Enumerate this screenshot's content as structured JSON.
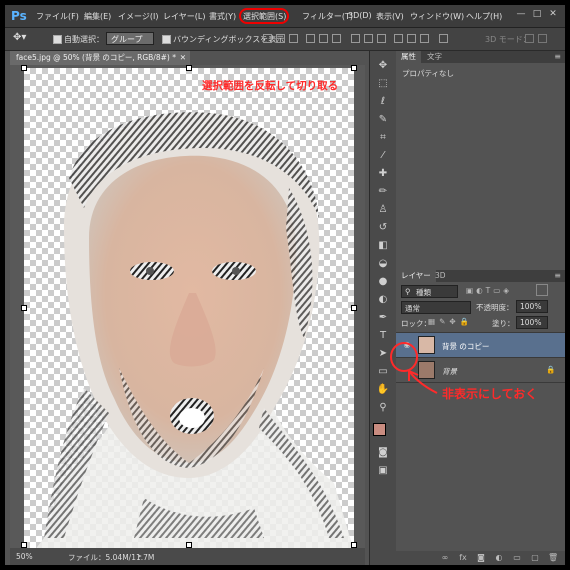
{
  "app": {
    "logo": "Ps"
  },
  "menubar": {
    "items": [
      "ファイル(F)",
      "編集(E)",
      "イメージ(I)",
      "レイヤー(L)",
      "書式(Y)",
      "選択範囲(S)",
      "フィルター(T)",
      "3D(D)",
      "表示(V)",
      "ウィンドウ(W)",
      "ヘルプ(H)"
    ],
    "highlighted_item": "選択範囲(S)",
    "window_controls": [
      "—",
      "□",
      "✕"
    ]
  },
  "options_bar": {
    "auto_select_label": "自動選択：",
    "auto_select_value": "グループ",
    "bounding_box_label": "バウンディングボックスを表示",
    "mode_3d_label": "3D モード："
  },
  "document": {
    "tab_title": "face5.jpg @ 50% (背景 のコピー, RGB/8#) *",
    "zoom": "50%",
    "file_info": "ファイル：5.04M/11.7M"
  },
  "properties_panel": {
    "tabs": [
      "属性",
      "文字"
    ],
    "content": "プロパティなし"
  },
  "layers_panel": {
    "tabs": [
      "レイヤー",
      "3D"
    ],
    "filter_kind": "種類",
    "blend_mode": "通常",
    "opacity_label": "不透明度：",
    "opacity_value": "100%",
    "lock_label": "ロック：",
    "fill_label": "塗り：",
    "fill_value": "100%",
    "layers": [
      {
        "name": "背景 のコピー",
        "visible": true,
        "selected": true
      },
      {
        "name": "背景",
        "visible": false,
        "selected": false,
        "locked": true
      }
    ]
  },
  "annotations": {
    "top": "選択範囲を反転して切り取る",
    "layers": "非表示にしておく"
  },
  "colors": {
    "annotation": "#ff2a2a",
    "selected_layer": "#59708e",
    "foreground_swatch": "#c98c80",
    "background_swatch": "#000000"
  }
}
